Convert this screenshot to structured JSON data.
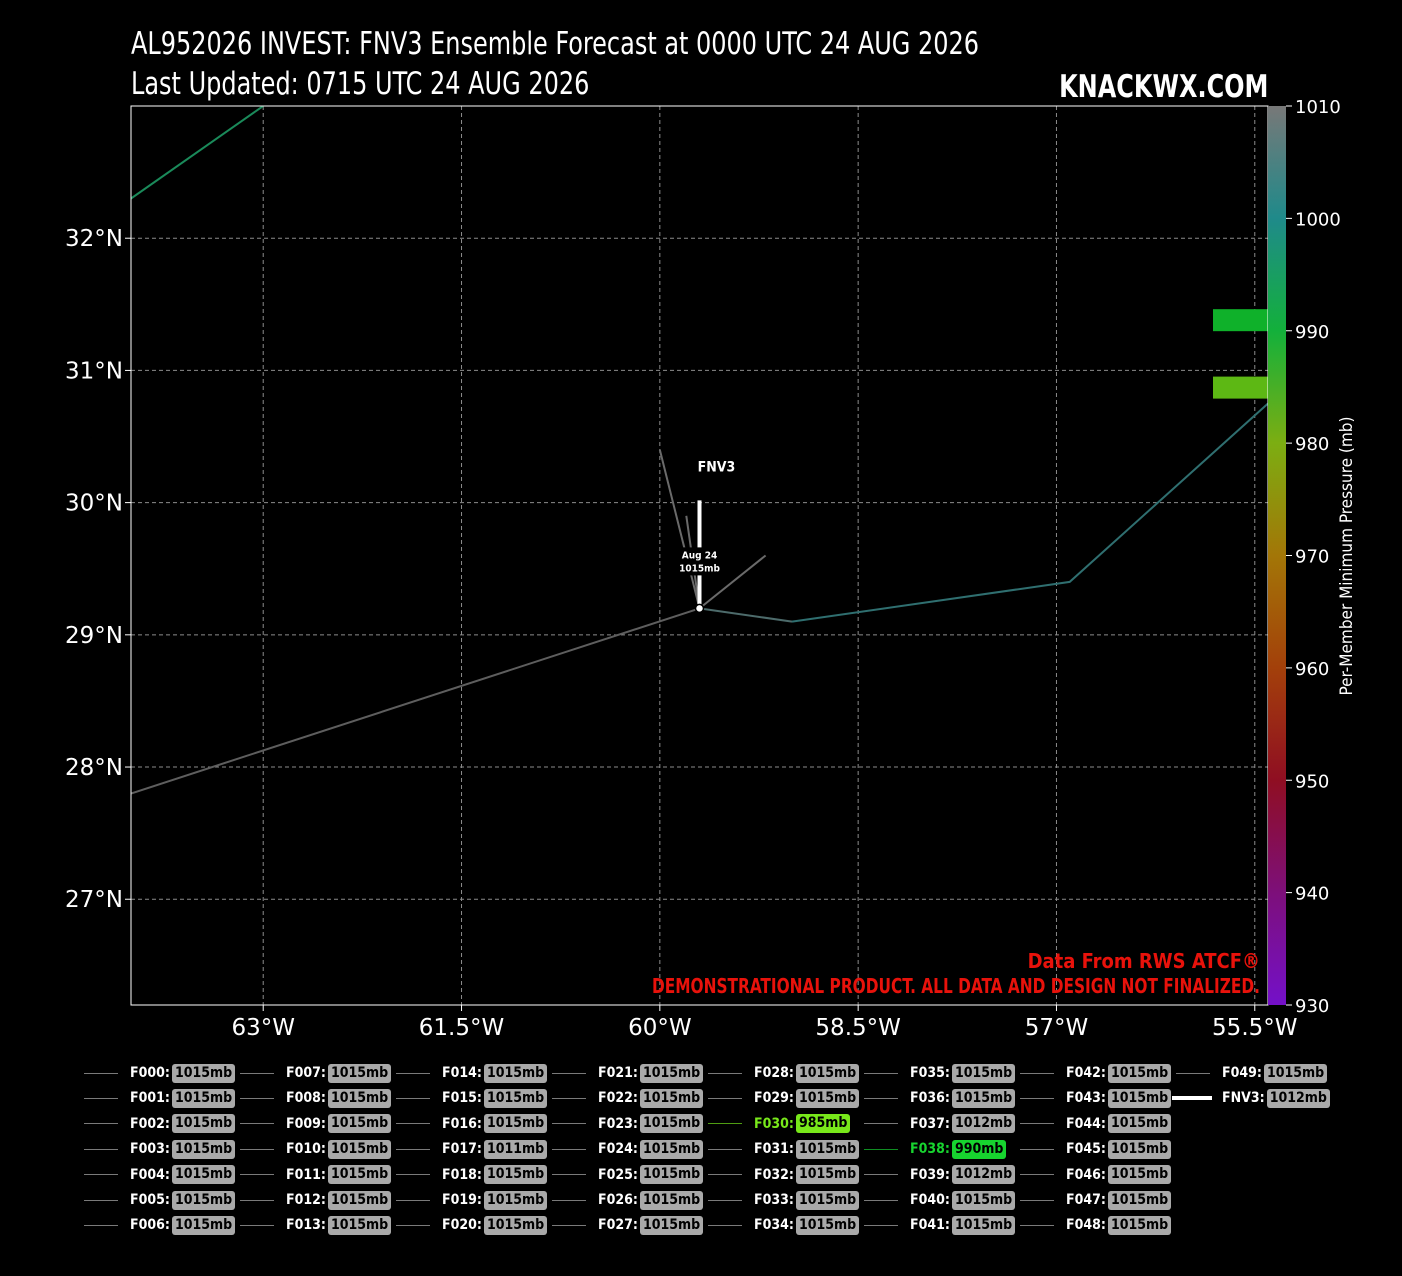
{
  "header": {
    "title_line1": "AL952026 INVEST: FNV3 Ensemble Forecast at 0000 UTC 24 AUG 2026",
    "title_line2": "Last Updated: 0715 UTC 24 AUG 2026",
    "brand": "KNACKWX.COM"
  },
  "map": {
    "lon_range": [
      -64.0,
      -55.4
    ],
    "lat_range": [
      26.2,
      33.0
    ],
    "lon_ticks": [
      {
        "v": -63.0,
        "label": "63°W"
      },
      {
        "v": -61.5,
        "label": "61.5°W"
      },
      {
        "v": -60.0,
        "label": "60°W"
      },
      {
        "v": -58.5,
        "label": "58.5°W"
      },
      {
        "v": -57.0,
        "label": "57°W"
      },
      {
        "v": -55.5,
        "label": "55.5°W"
      }
    ],
    "lat_ticks": [
      {
        "v": 32,
        "label": "32°N"
      },
      {
        "v": 31,
        "label": "31°N"
      },
      {
        "v": 30,
        "label": "30°N"
      },
      {
        "v": 29,
        "label": "29°N"
      },
      {
        "v": 28,
        "label": "28°N"
      },
      {
        "v": 27,
        "label": "27°N"
      }
    ],
    "grid": true,
    "tracks": [
      {
        "color": "#5e5e5e",
        "points": [
          [
            -64.0,
            27.8
          ],
          [
            -59.7,
            29.2
          ]
        ]
      },
      {
        "color": "#4d6b6b",
        "points": [
          [
            -59.7,
            29.2
          ],
          [
            -59.0,
            29.1
          ]
        ]
      },
      {
        "color": "#2f6f70",
        "points": [
          [
            -59.0,
            29.1
          ],
          [
            -56.9,
            29.4
          ],
          [
            -55.4,
            30.75
          ]
        ]
      },
      {
        "color": "#6a6a6a",
        "points": [
          [
            -59.7,
            29.2
          ],
          [
            -59.2,
            29.6
          ]
        ]
      },
      {
        "color": "#6a6a6a",
        "points": [
          [
            -59.7,
            29.2
          ],
          [
            -60.0,
            30.4
          ]
        ]
      },
      {
        "color": "#6a6a6a",
        "points": [
          [
            -59.7,
            29.2
          ],
          [
            -59.8,
            29.9
          ]
        ]
      },
      {
        "color": "#1a8a5a",
        "points": [
          [
            -64.0,
            32.3
          ],
          [
            -63.0,
            33.0
          ]
        ]
      }
    ],
    "fnv3": {
      "label": "FNV3",
      "date": "Aug 24",
      "pressure": "1015mb",
      "lon": -59.7,
      "lat": 29.2
    },
    "bars": [
      {
        "lat": 31.38,
        "color": "#0fb12a"
      },
      {
        "lat": 30.87,
        "color": "#5db814"
      }
    ],
    "credit_line1": "Data From RWS ATCF®",
    "credit_line2": "DEMONSTRATIONAL PRODUCT. ALL DATA AND DESIGN NOT FINALIZED.",
    "credit_color": "#e8120b"
  },
  "colorbar": {
    "label": "Per-Member Minimum Pressure (mb)",
    "range": [
      930,
      1010
    ],
    "ticks": [
      1010,
      1000,
      990,
      980,
      970,
      960,
      950,
      940,
      930
    ],
    "stops": [
      "#787878",
      "#1f8a8a",
      "#13b03b",
      "#7cae12",
      "#a37607",
      "#a3400a",
      "#8f0e22",
      "#7d0f7a",
      "#7410c9"
    ]
  },
  "legend": {
    "members": [
      {
        "name": "F000:",
        "value": "1015mb"
      },
      {
        "name": "F001:",
        "value": "1015mb"
      },
      {
        "name": "F002:",
        "value": "1015mb"
      },
      {
        "name": "F003:",
        "value": "1015mb"
      },
      {
        "name": "F004:",
        "value": "1015mb"
      },
      {
        "name": "F005:",
        "value": "1015mb"
      },
      {
        "name": "F006:",
        "value": "1015mb"
      },
      {
        "name": "F007:",
        "value": "1015mb"
      },
      {
        "name": "F008:",
        "value": "1015mb"
      },
      {
        "name": "F009:",
        "value": "1015mb"
      },
      {
        "name": "F010:",
        "value": "1015mb"
      },
      {
        "name": "F011:",
        "value": "1015mb"
      },
      {
        "name": "F012:",
        "value": "1015mb"
      },
      {
        "name": "F013:",
        "value": "1015mb"
      },
      {
        "name": "F014:",
        "value": "1015mb"
      },
      {
        "name": "F015:",
        "value": "1015mb"
      },
      {
        "name": "F016:",
        "value": "1015mb"
      },
      {
        "name": "F017:",
        "value": "1011mb"
      },
      {
        "name": "F018:",
        "value": "1015mb"
      },
      {
        "name": "F019:",
        "value": "1015mb"
      },
      {
        "name": "F020:",
        "value": "1015mb"
      },
      {
        "name": "F021:",
        "value": "1015mb"
      },
      {
        "name": "F022:",
        "value": "1015mb"
      },
      {
        "name": "F023:",
        "value": "1015mb"
      },
      {
        "name": "F024:",
        "value": "1015mb"
      },
      {
        "name": "F025:",
        "value": "1015mb"
      },
      {
        "name": "F026:",
        "value": "1015mb"
      },
      {
        "name": "F027:",
        "value": "1015mb"
      },
      {
        "name": "F028:",
        "value": "1015mb"
      },
      {
        "name": "F029:",
        "value": "1015mb"
      },
      {
        "name": "F030:",
        "value": "985mb",
        "color": "#78e81a",
        "line": "#4f9d12"
      },
      {
        "name": "F031:",
        "value": "1015mb"
      },
      {
        "name": "F032:",
        "value": "1015mb"
      },
      {
        "name": "F033:",
        "value": "1015mb"
      },
      {
        "name": "F034:",
        "value": "1015mb"
      },
      {
        "name": "F035:",
        "value": "1015mb"
      },
      {
        "name": "F036:",
        "value": "1015mb"
      },
      {
        "name": "F037:",
        "value": "1012mb"
      },
      {
        "name": "F038:",
        "value": "990mb",
        "color": "#17d42f",
        "line": "#0f8e22"
      },
      {
        "name": "F039:",
        "value": "1012mb"
      },
      {
        "name": "F040:",
        "value": "1015mb"
      },
      {
        "name": "F041:",
        "value": "1015mb"
      },
      {
        "name": "F042:",
        "value": "1015mb"
      },
      {
        "name": "F043:",
        "value": "1015mb"
      },
      {
        "name": "F044:",
        "value": "1015mb"
      },
      {
        "name": "F045:",
        "value": "1015mb"
      },
      {
        "name": "F046:",
        "value": "1015mb"
      },
      {
        "name": "F047:",
        "value": "1015mb"
      },
      {
        "name": "F048:",
        "value": "1015mb"
      },
      {
        "name": "F049:",
        "value": "1015mb"
      },
      {
        "name": "FNV3:",
        "value": "1012mb",
        "line": "#ffffff",
        "thick": true
      }
    ]
  }
}
